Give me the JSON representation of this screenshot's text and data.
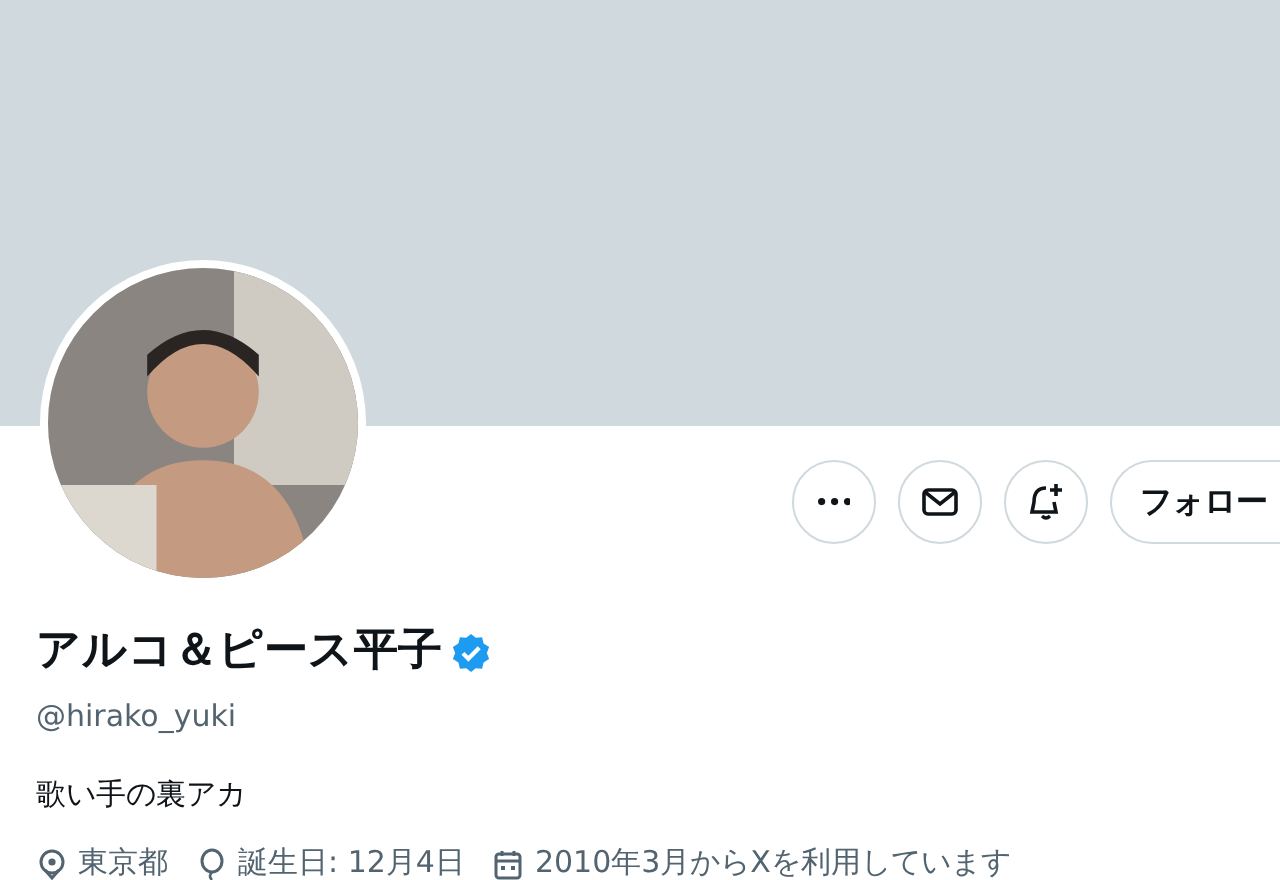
{
  "profile": {
    "name": "アルコ＆ピース平子",
    "verified": true,
    "handle": "@hirako_yuki",
    "bio": "歌い手の裏アカ",
    "meta": [
      {
        "kind": "location",
        "text": "東京都"
      },
      {
        "kind": "birthday",
        "text": "誕生日: 12月4日"
      },
      {
        "kind": "joined",
        "text": "2010年3月からXを利用しています"
      }
    ]
  },
  "actions": {
    "follow_label": "フォロー"
  }
}
